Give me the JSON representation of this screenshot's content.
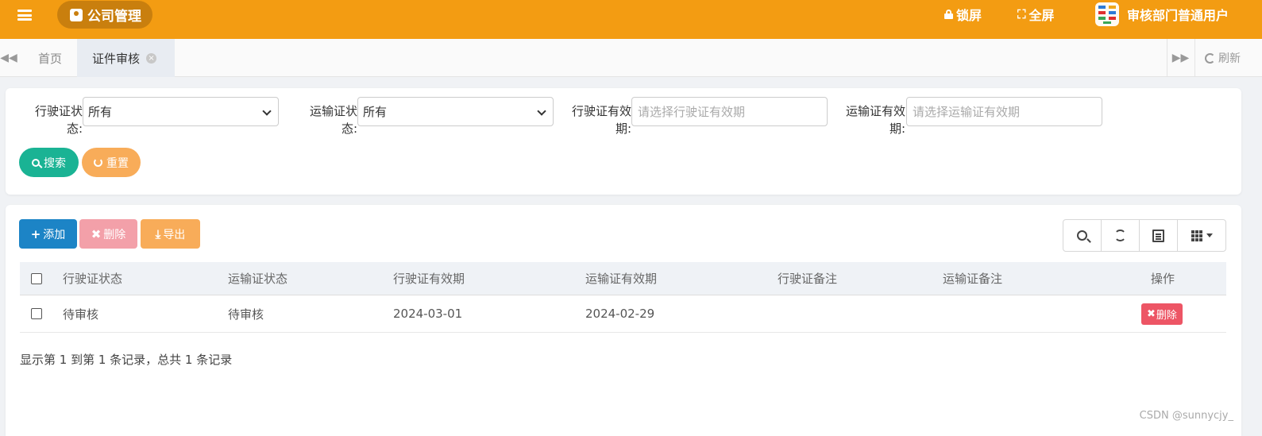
{
  "header": {
    "company_name": "公司管理",
    "lock_label": "锁屏",
    "fullscreen_label": "全屏",
    "user_name": "审核部门普通用户",
    "bg_color": "#f39c12"
  },
  "tabs": {
    "home_label": "首页",
    "active_label": "证件审核",
    "refresh_label": "刷新"
  },
  "search": {
    "driving_status_label": "行驶证状态:",
    "driving_status_value": "所有",
    "transport_status_label": "运输证状态:",
    "transport_status_value": "所有",
    "driving_validity_label": "行驶证有效期:",
    "driving_validity_placeholder": "请选择行驶证有效期",
    "transport_validity_label": "运输证有效期:",
    "transport_validity_placeholder": "请选择运输证有效期",
    "search_label": "搜索",
    "reset_label": "重置"
  },
  "toolbar": {
    "add_label": "添加",
    "delete_label": "删除",
    "export_label": "导出"
  },
  "table": {
    "columns": [
      "行驶证状态",
      "运输证状态",
      "行驶证有效期",
      "运输证有效期",
      "行驶证备注",
      "运输证备注",
      "操作"
    ],
    "rows": [
      {
        "driving_status": "待审核",
        "transport_status": "待审核",
        "driving_validity": "2024-03-01",
        "transport_validity": "2024-02-29",
        "driving_note": "",
        "transport_note": "",
        "action_label": "删除"
      }
    ]
  },
  "pagination": {
    "info": "显示第 1 到第 1 条记录，总共 1 条记录"
  },
  "watermark": "CSDN @sunnycjy_"
}
